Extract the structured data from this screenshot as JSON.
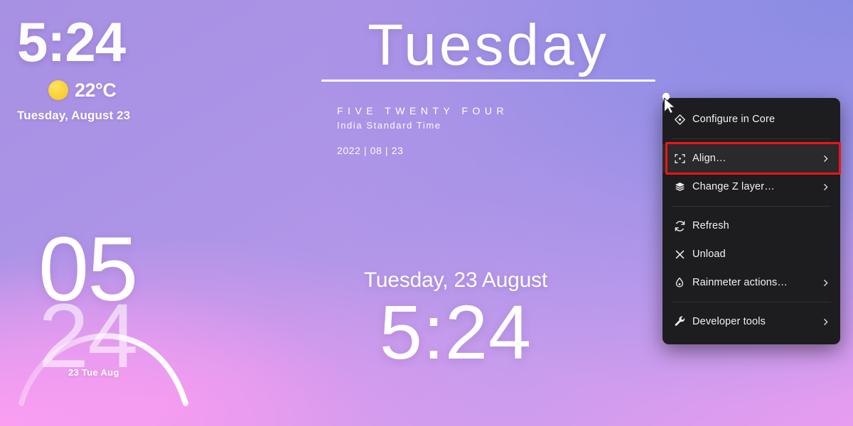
{
  "background": {
    "gradient_from": "#a791e3",
    "gradient_mid": "#b296e8",
    "gradient_to": "#f09cf0"
  },
  "top_left_clock": {
    "time": "5:24",
    "weather_icon": "sun-icon",
    "temperature": "22°C",
    "date": "Tuesday, August 23",
    "sun_color": "#fbd13a"
  },
  "day_widget": {
    "day_name": "Tuesday",
    "time_spelled": "FIVE  TWENTY  FOUR",
    "timezone": "India Standard Time",
    "ymd": "2022 | 08 | 23"
  },
  "big_digits_widget": {
    "hour": "05",
    "minute": "24",
    "sub_label": "23 Tue Aug"
  },
  "lock_clock": {
    "date": "Tuesday, 23 August",
    "time": "5:24"
  },
  "context_menu": {
    "background": "#1d1d1f",
    "hover_background": "#2a2a2d",
    "highlight_color": "#f01414",
    "items": [
      {
        "id": "configure-in-core",
        "label": "Configure in Core",
        "icon": "gem-icon",
        "submenu": false,
        "hover": false,
        "highlighted": false
      },
      {
        "id": "align",
        "label": "Align…",
        "icon": "crop-icon",
        "submenu": true,
        "hover": true,
        "highlighted": true
      },
      {
        "id": "change-z-layer",
        "label": "Change Z layer…",
        "icon": "layers-icon",
        "submenu": true,
        "hover": false,
        "highlighted": false
      },
      {
        "id": "refresh",
        "label": "Refresh",
        "icon": "refresh-icon",
        "submenu": false,
        "hover": false,
        "highlighted": false
      },
      {
        "id": "unload",
        "label": "Unload",
        "icon": "close-icon",
        "submenu": false,
        "hover": false,
        "highlighted": false
      },
      {
        "id": "rainmeter-actions",
        "label": "Rainmeter actions…",
        "icon": "droplet-icon",
        "submenu": true,
        "hover": false,
        "highlighted": false
      },
      {
        "id": "developer-tools",
        "label": "Developer tools",
        "icon": "wrench-icon",
        "submenu": true,
        "hover": false,
        "highlighted": false
      }
    ]
  },
  "cursor": {
    "type": "arrow-cursor"
  }
}
